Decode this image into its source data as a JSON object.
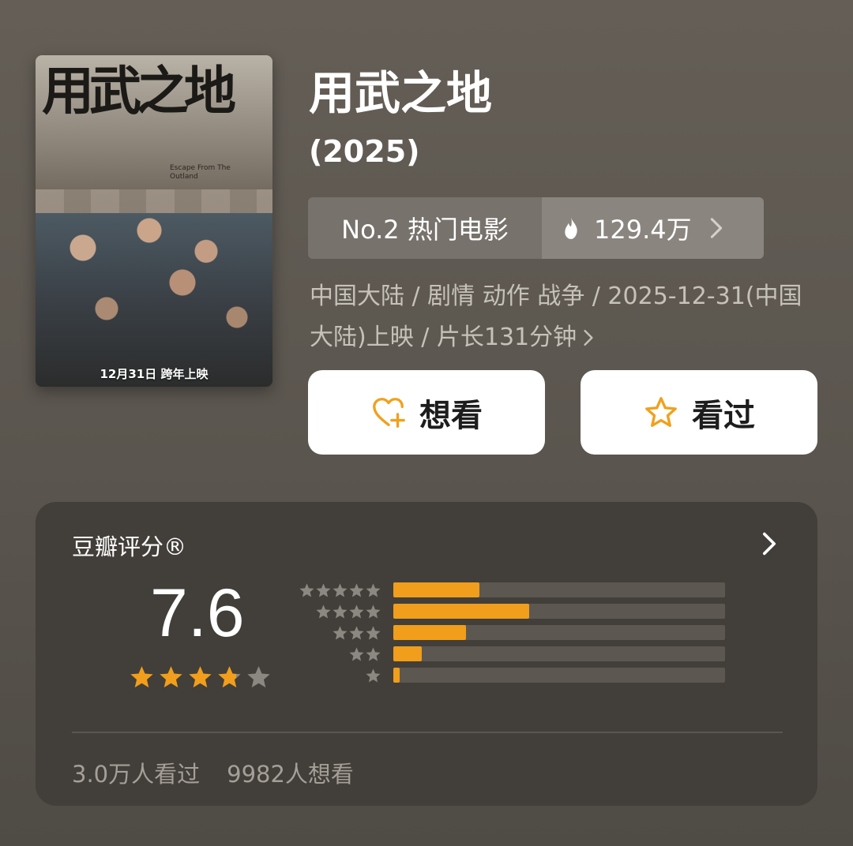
{
  "poster": {
    "title_art": "用武之地",
    "subtitle_art": "Escape From The Outland",
    "release_text": "12月31日 跨年上映"
  },
  "movie": {
    "title": "用武之地",
    "year": "(2025)"
  },
  "rank": {
    "label": "No.2 热门电影",
    "heat": "129.4万",
    "icon": "fire-icon"
  },
  "meta": {
    "text": "中国大陆 / 剧情 动作 战争 / 2025-12-31(中国大陆)上映 / 片长131分钟"
  },
  "actions": {
    "want_label": "想看",
    "seen_label": "看过"
  },
  "rating": {
    "label": "豆瓣评分®",
    "score": "7.6",
    "stars": 3.8,
    "distribution": [
      {
        "stars": 5,
        "percent": 26
      },
      {
        "stars": 4,
        "percent": 41
      },
      {
        "stars": 3,
        "percent": 22
      },
      {
        "stars": 2,
        "percent": 8.5
      },
      {
        "stars": 1,
        "percent": 2
      }
    ],
    "seen_count": "3.0万人看过",
    "want_count": "9982人想看"
  },
  "colors": {
    "accent": "#f09e1b",
    "star_empty": "#8b8781"
  }
}
